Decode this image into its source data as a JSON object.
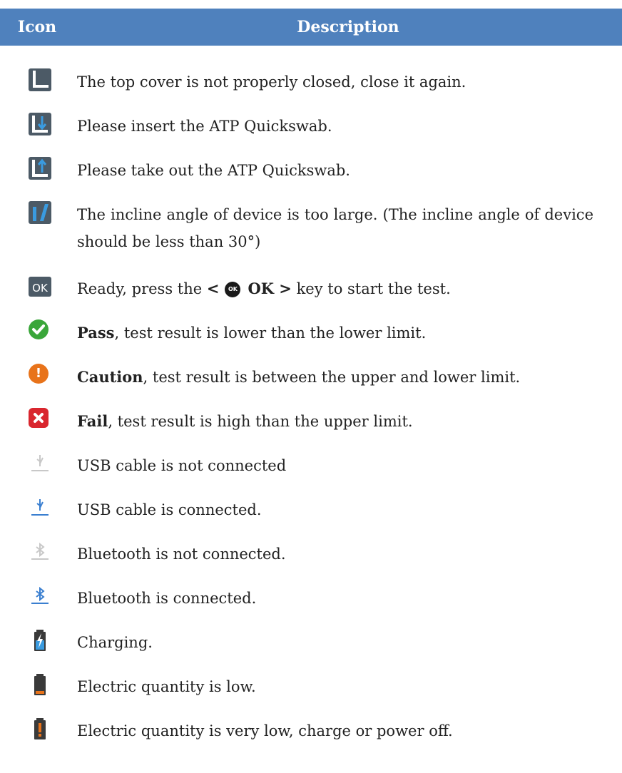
{
  "table": {
    "header": {
      "icon": "Icon",
      "description": "Description"
    },
    "rows": [
      {
        "icon": "cover-open-icon",
        "text": "The top cover is not properly closed, close it again."
      },
      {
        "icon": "insert-swab-icon",
        "text": "Please insert the ATP Quickswab."
      },
      {
        "icon": "remove-swab-icon",
        "text": "Please take out the ATP Quickswab."
      },
      {
        "icon": "incline-icon",
        "text": "The incline angle of device is too large. (The incline angle of device should be less than 30°)"
      },
      {
        "icon": "ok-ready-icon",
        "before": "Ready, press the ",
        "key_open": "<",
        "key_icon": "OK",
        "key_label": "OK >",
        "after": " key to start the test."
      },
      {
        "icon": "pass-icon",
        "bold": "Pass",
        "text": ", test result is lower than the lower limit."
      },
      {
        "icon": "caution-icon",
        "bold": "Caution",
        "text": ", test result is between the upper and lower limit."
      },
      {
        "icon": "fail-icon",
        "bold": "Fail",
        "text": ", test result is high than the upper limit."
      },
      {
        "icon": "usb-disconnected-icon",
        "text": "USB cable is not connected"
      },
      {
        "icon": "usb-connected-icon",
        "text": "USB cable is connected."
      },
      {
        "icon": "bluetooth-disconnected-icon",
        "text": "Bluetooth is not connected."
      },
      {
        "icon": "bluetooth-connected-icon",
        "text": "Bluetooth is connected."
      },
      {
        "icon": "battery-charging-icon",
        "text": "Charging."
      },
      {
        "icon": "battery-low-icon",
        "text": "Electric quantity is low."
      },
      {
        "icon": "battery-very-low-icon",
        "text": "Electric quantity is very low, charge or power off."
      }
    ]
  },
  "colors": {
    "header_bg": "#4f81bd",
    "pass": "#3aa63a",
    "caution": "#e8731a",
    "fail": "#d9262e",
    "connected_blue": "#3a7fd0"
  }
}
